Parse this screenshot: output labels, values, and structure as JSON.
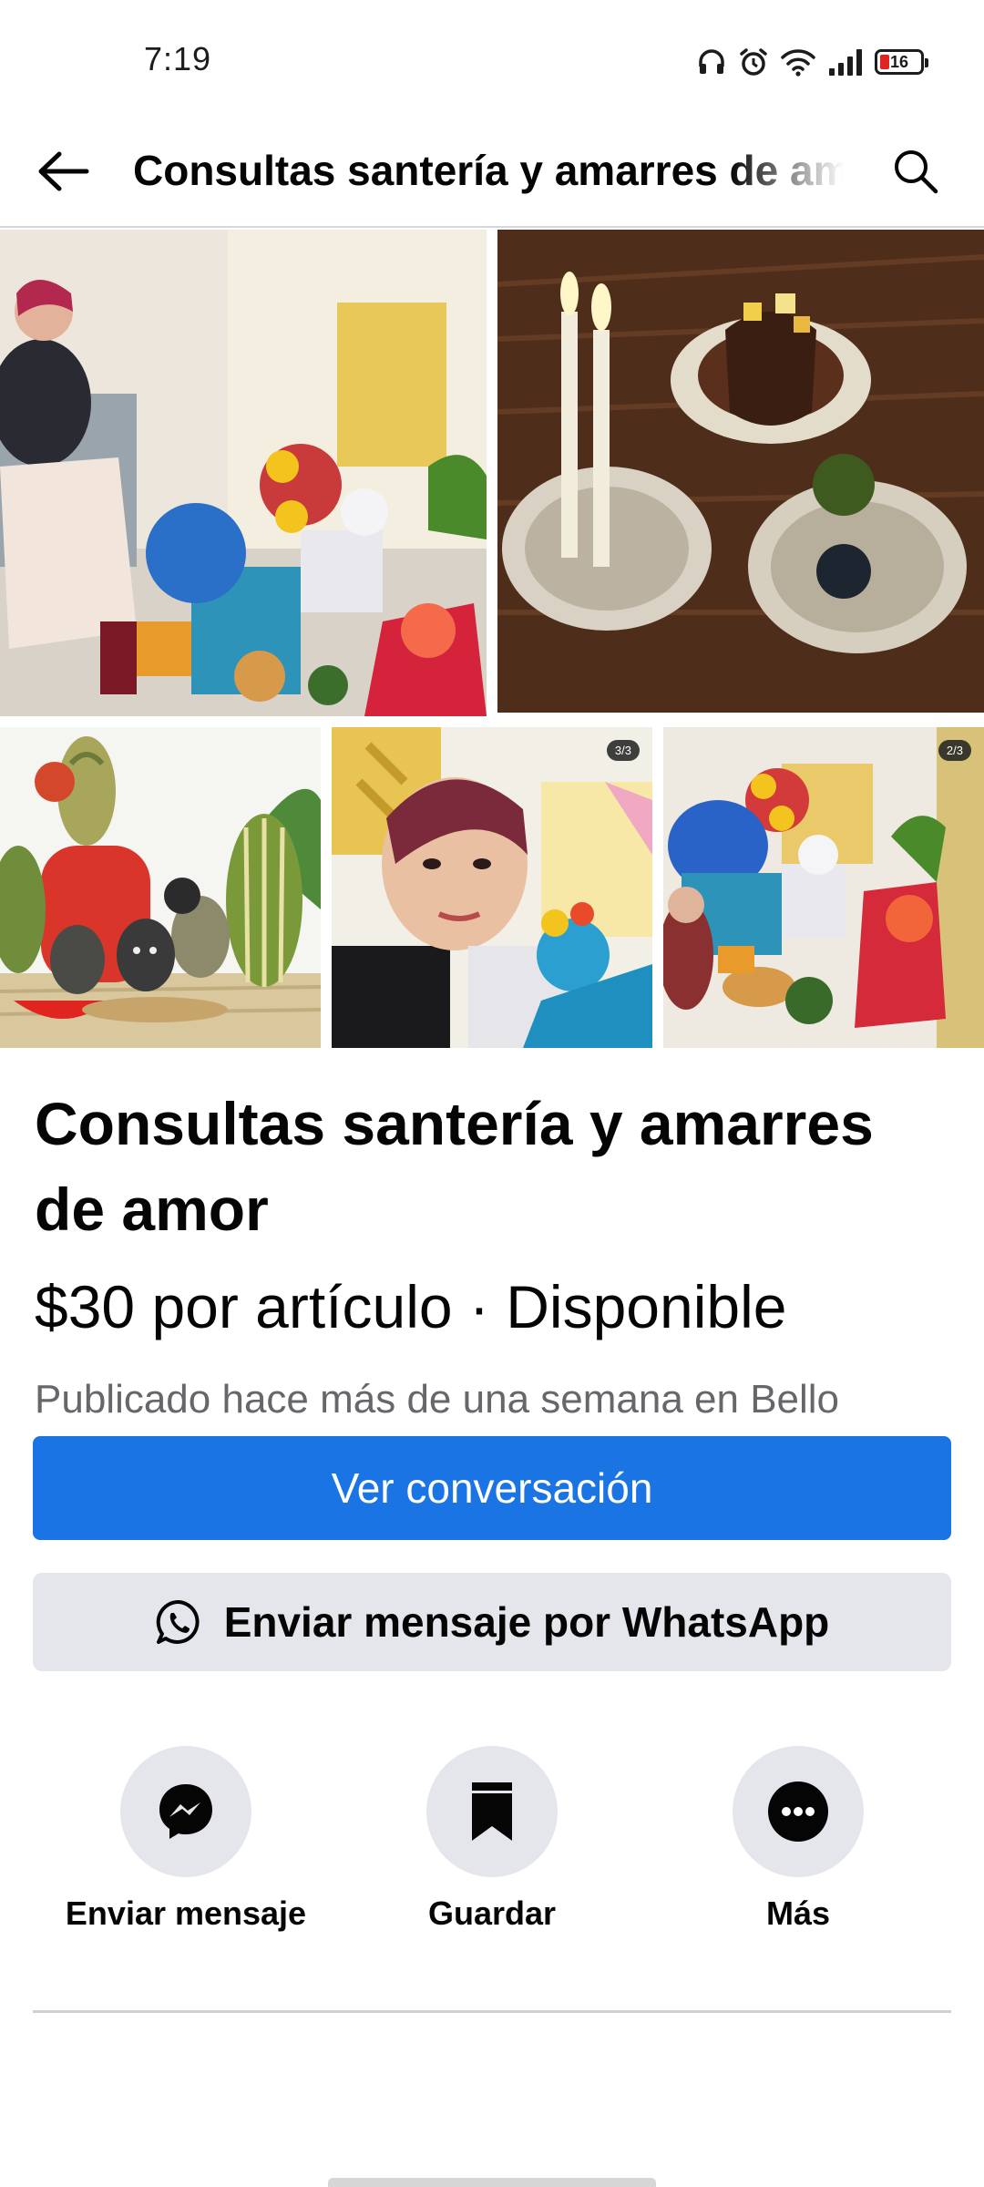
{
  "status_bar": {
    "time": "7:19",
    "battery_level": "16",
    "icons": [
      "headphones-icon",
      "alarm-icon",
      "wifi-icon",
      "signal-icon",
      "battery-icon"
    ]
  },
  "header": {
    "title": "Consultas santería y amarres de amor",
    "back_icon": "arrow-left-icon",
    "search_icon": "search-icon"
  },
  "photos": {
    "counter_4": "3/3",
    "counter_5": "2/3"
  },
  "listing": {
    "title": "Consultas santería y amarres de amor",
    "price_line": "$30 por artículo · Disponible",
    "meta": "Publicado hace más de una semana en Bello"
  },
  "buttons": {
    "primary_label": "Ver conversación",
    "whatsapp_label": "Enviar mensaje por WhatsApp"
  },
  "actions": [
    {
      "label": "Enviar mensaje",
      "icon": "messenger-icon"
    },
    {
      "label": "Guardar",
      "icon": "bookmark-icon"
    },
    {
      "label": "Más",
      "icon": "more-icon"
    }
  ],
  "colors": {
    "accent": "#1b74e4",
    "secondary_bg": "#e4e6eb",
    "muted_text": "#65676b",
    "battery_low": "#e02424"
  }
}
